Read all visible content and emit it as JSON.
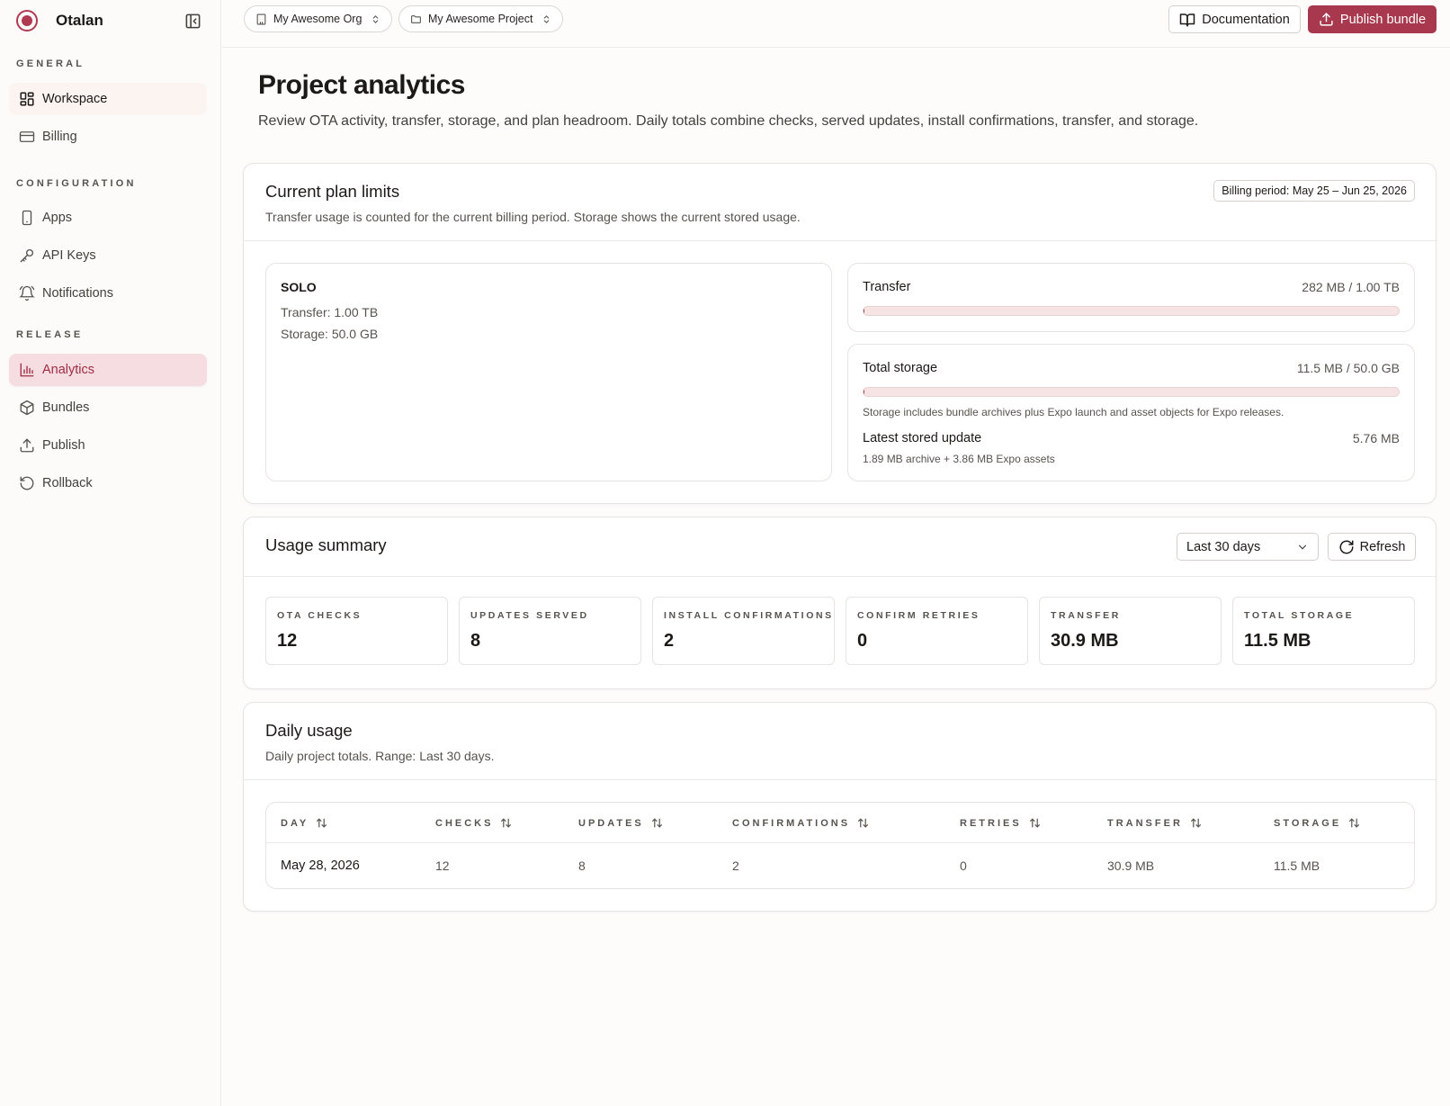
{
  "brand": {
    "name": "Otalan",
    "accent": "#a8384e"
  },
  "sidebar": {
    "sections": [
      {
        "title": "GENERAL",
        "items": [
          {
            "label": "Workspace",
            "icon": "grid-icon"
          },
          {
            "label": "Billing",
            "icon": "credit-card-icon"
          }
        ]
      },
      {
        "title": "CONFIGURATION",
        "items": [
          {
            "label": "Apps",
            "icon": "smartphone-icon"
          },
          {
            "label": "API Keys",
            "icon": "key-icon"
          },
          {
            "label": "Notifications",
            "icon": "bell-icon"
          }
        ]
      },
      {
        "title": "RELEASE",
        "items": [
          {
            "label": "Analytics",
            "icon": "bar-chart-icon",
            "active": true
          },
          {
            "label": "Bundles",
            "icon": "package-icon"
          },
          {
            "label": "Publish",
            "icon": "upload-icon"
          },
          {
            "label": "Rollback",
            "icon": "rotate-ccw-icon"
          }
        ]
      }
    ]
  },
  "topbar": {
    "org": "My Awesome Org",
    "project": "My Awesome Project",
    "docs_label": "Documentation",
    "publish_label": "Publish bundle"
  },
  "page": {
    "title": "Project analytics",
    "description": "Review OTA activity, transfer, storage, and plan headroom. Daily totals combine checks, served updates, install confirmations, transfer, and storage."
  },
  "plan_limits": {
    "title": "Current plan limits",
    "subtitle": "Transfer usage is counted for the current billing period. Storage shows the current stored usage.",
    "billing_period": "Billing period: May 25 – Jun 25, 2026",
    "plan": {
      "name": "SOLO",
      "transfer": "Transfer: 1.00 TB",
      "storage": "Storage: 50.0 GB"
    },
    "transfer": {
      "label": "Transfer",
      "value": "282 MB / 1.00 TB",
      "fraction": 0.0003
    },
    "storage": {
      "label": "Total storage",
      "value": "11.5 MB / 50.0 GB",
      "fraction": 0.0002,
      "note": "Storage includes bundle archives plus Expo launch and asset objects for Expo releases.",
      "latest_label": "Latest stored update",
      "latest_value": "5.76 MB",
      "latest_detail": "1.89 MB archive + 3.86 MB Expo assets"
    }
  },
  "usage_summary": {
    "title": "Usage summary",
    "range": "Last 30 days",
    "refresh_label": "Refresh",
    "stats": [
      {
        "label": "OTA CHECKS",
        "value": "12"
      },
      {
        "label": "UPDATES SERVED",
        "value": "8"
      },
      {
        "label": "INSTALL CONFIRMATIONS",
        "value": "2"
      },
      {
        "label": "CONFIRM RETRIES",
        "value": "0"
      },
      {
        "label": "TRANSFER",
        "value": "30.9 MB"
      },
      {
        "label": "TOTAL STORAGE",
        "value": "11.5 MB"
      }
    ]
  },
  "daily_usage": {
    "title": "Daily usage",
    "subtitle": "Daily project totals. Range: Last 30 days.",
    "columns": [
      "DAY",
      "CHECKS",
      "UPDATES",
      "CONFIRMATIONS",
      "RETRIES",
      "TRANSFER",
      "STORAGE"
    ],
    "rows": [
      [
        "May 28, 2026",
        "12",
        "8",
        "2",
        "0",
        "30.9 MB",
        "11.5 MB"
      ]
    ]
  }
}
